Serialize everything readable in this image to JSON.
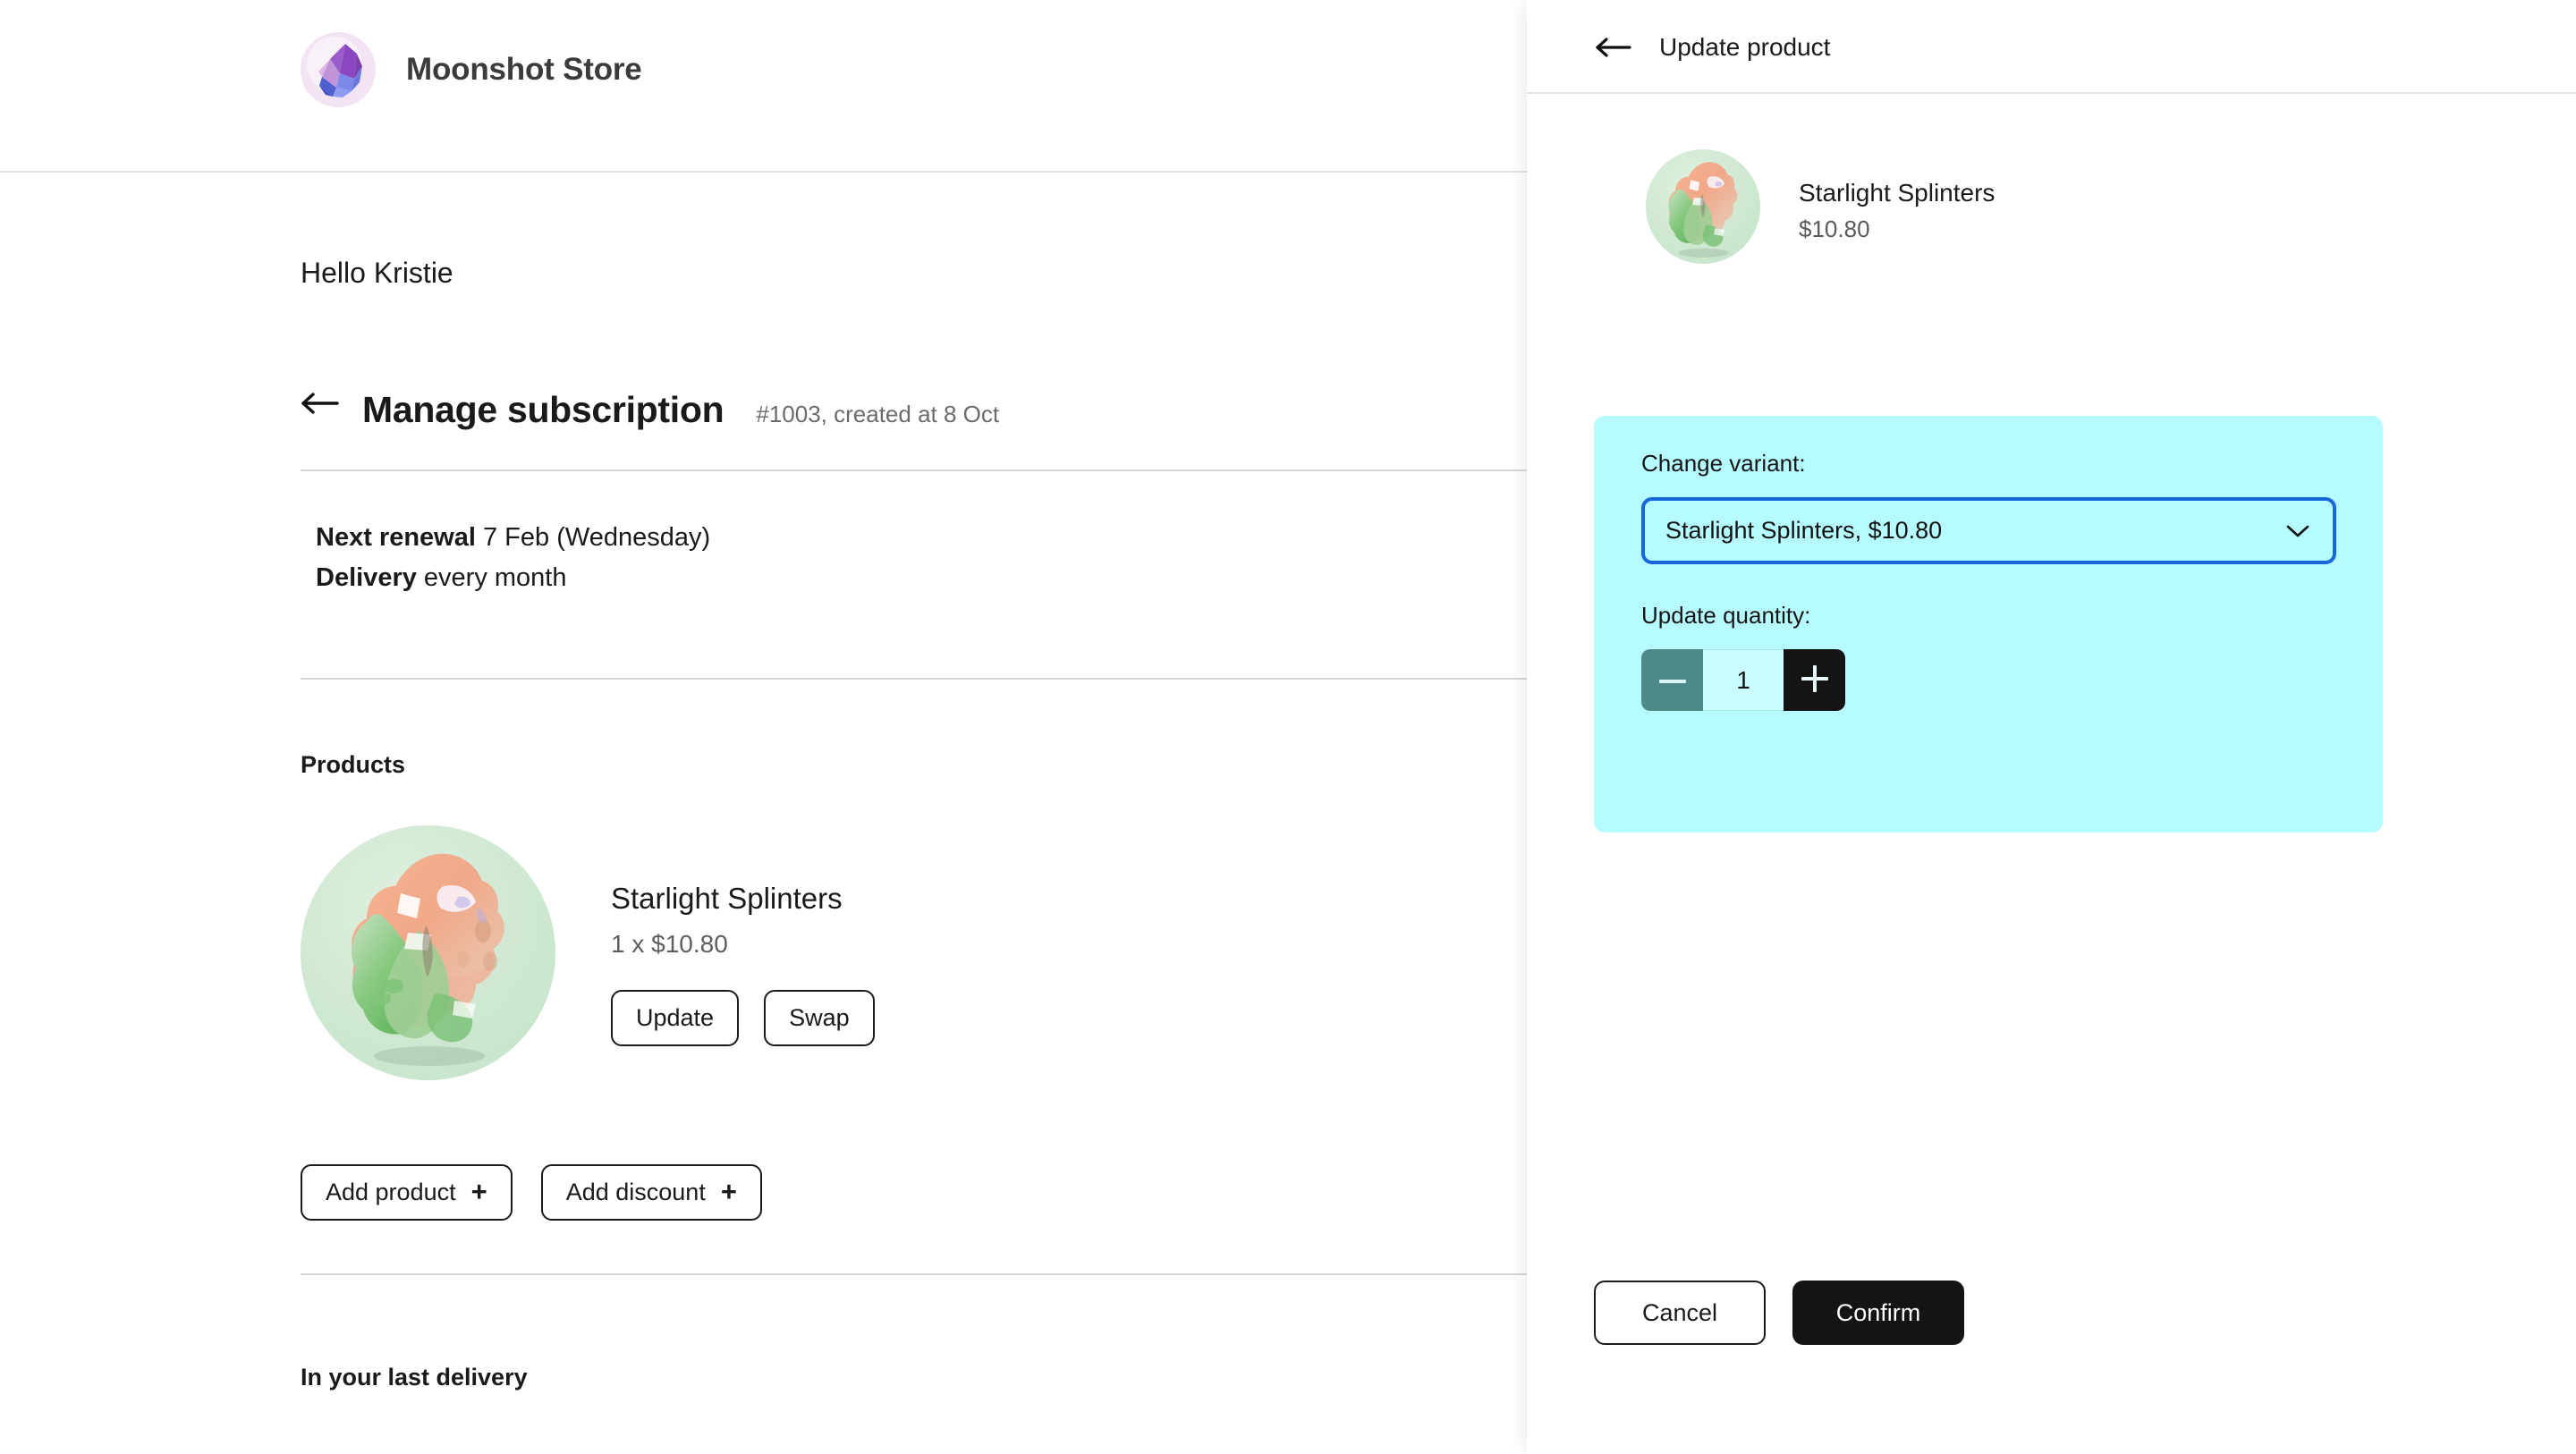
{
  "store": {
    "name": "Moonshot Store",
    "logo_icon": "crystal-logo-icon",
    "logo_colors": {
      "purple": "#8b4fc4",
      "blue": "#5a6fd8",
      "lavender": "#c79ad8",
      "bg": "#f3e6f3"
    }
  },
  "main": {
    "greeting": "Hello Kristie",
    "back_icon": "arrow-left-icon",
    "page_title": "Manage subscription",
    "order_meta": "#1003, created at 8 Oct",
    "details": [
      {
        "label": "Next renewal",
        "value": "7 Feb (Wednesday)"
      },
      {
        "label": "Delivery",
        "value": "every month"
      }
    ],
    "products_heading": "Products",
    "product": {
      "title": "Starlight Splinters",
      "quantity_price": "1 x $10.80",
      "image_icon": "product-crystal-image",
      "update_label": "Update",
      "swap_label": "Swap"
    },
    "add_product_label": "Add product",
    "add_discount_label": "Add discount",
    "plus_icon": "plus-icon",
    "last_delivery_heading": "In your last delivery"
  },
  "panel": {
    "back_icon": "arrow-left-icon",
    "title": "Update product",
    "product": {
      "title": "Starlight Splinters",
      "price": "$10.80",
      "image_icon": "product-crystal-image"
    },
    "variant": {
      "label": "Change variant:",
      "selected": "Starlight Splinters, $10.80",
      "options": [
        "Starlight Splinters, $10.80"
      ],
      "chevron_icon": "chevron-down-icon",
      "border_color": "#1668d6"
    },
    "quantity": {
      "label": "Update quantity:",
      "value": "1",
      "minus_icon": "minus-icon",
      "plus_icon": "plus-icon",
      "minus_color": "#4f8a8b",
      "plus_color": "#141414"
    },
    "card_color": "#b5fbff",
    "cancel_label": "Cancel",
    "confirm_label": "Confirm"
  }
}
